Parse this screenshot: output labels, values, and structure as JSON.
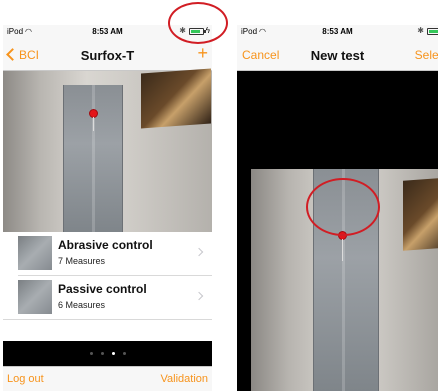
{
  "status_bar": {
    "carrier": "iPod",
    "time": "8:53 AM"
  },
  "left_screen": {
    "nav": {
      "back_label": "BCI",
      "title": "Surfox-T",
      "add_label": "+"
    },
    "list_items": [
      {
        "title": "Abrasive control",
        "subtitle": "7 Measures"
      },
      {
        "title": "Passive control",
        "subtitle": "6 Measures"
      }
    ],
    "page_indicator": {
      "count": 4,
      "active_index": 2
    },
    "toolbar": {
      "left_label": "Log out",
      "right_label": "Validation"
    }
  },
  "right_screen": {
    "nav": {
      "cancel_label": "Cancel",
      "title": "New test",
      "select_label": "Select"
    }
  },
  "colors": {
    "accent": "#f7941d",
    "annotation": "#d11d24",
    "pin": "#e3151a"
  }
}
